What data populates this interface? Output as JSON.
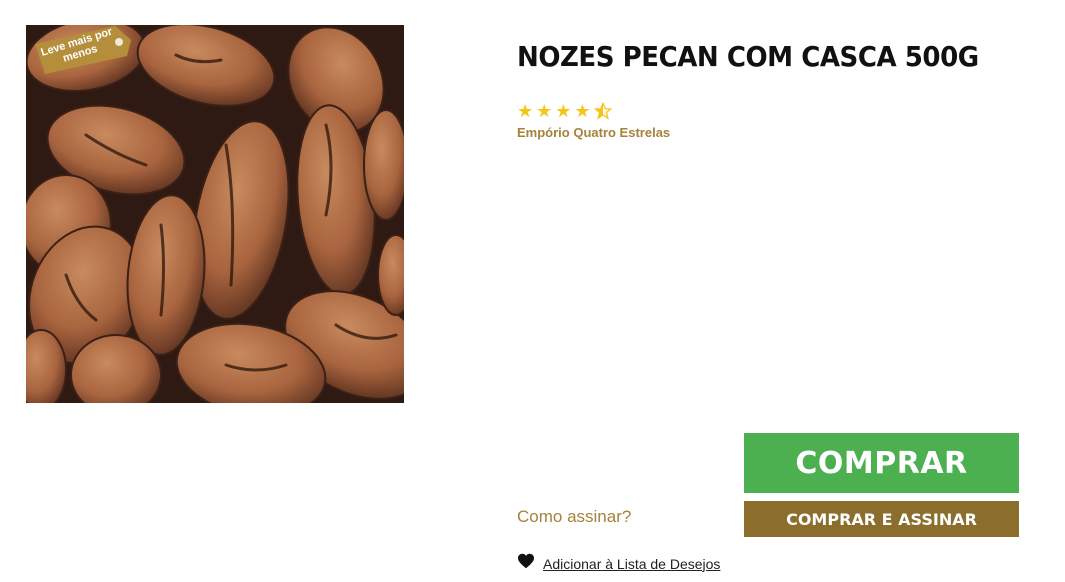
{
  "product": {
    "title": "NOZES PECAN COM CASCA 500G",
    "brand": "Empório Quatro Estrelas",
    "rating": 4.5,
    "rating_max": 5,
    "image_alt": "Nozes pecan com casca",
    "promo_tag": "Leve mais por menos"
  },
  "actions": {
    "buy_label": "COMPRAR",
    "subscribe_label": "COMPRAR E ASSINAR",
    "how_subscribe_label": "Como assinar?",
    "wishlist_label": "Adicionar à Lista de Desejos"
  },
  "colors": {
    "buy": "#4caf50",
    "subscribe": "#8b6d2c",
    "accent": "#a6823a",
    "star": "#f5c518"
  },
  "icons": {
    "stars": "star-icon",
    "wishlist": "heart-icon"
  }
}
